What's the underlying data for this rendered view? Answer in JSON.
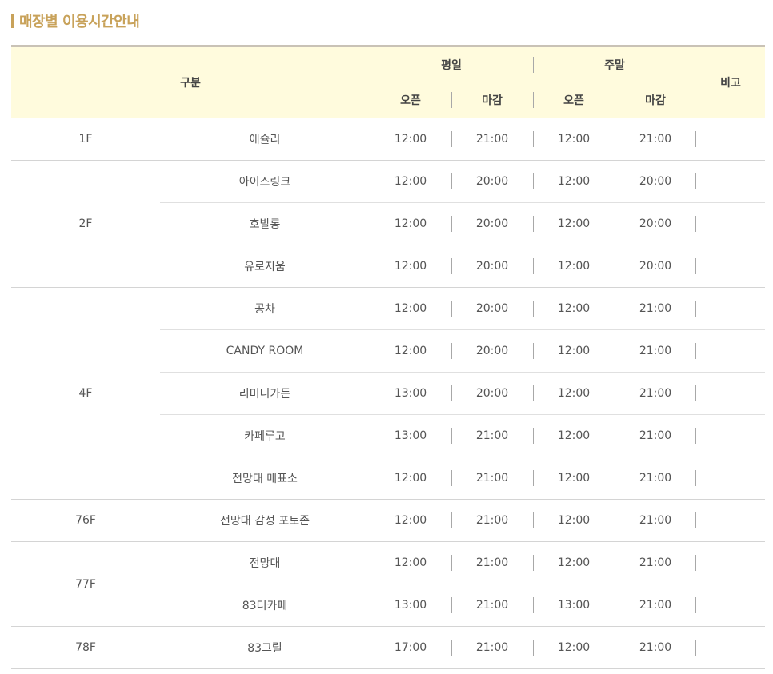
{
  "title": "매장별 이용시간안내",
  "header": {
    "gubun": "구분",
    "weekday": "평일",
    "weekend": "주말",
    "open": "오픈",
    "close": "마감",
    "note": "비고"
  },
  "rows": [
    {
      "floor": "1F",
      "name": "애슐리",
      "wd_open": "12:00",
      "wd_close": "21:00",
      "we_open": "12:00",
      "we_close": "21:00"
    },
    {
      "floor": "2F",
      "name": "아이스링크",
      "wd_open": "12:00",
      "wd_close": "20:00",
      "we_open": "12:00",
      "we_close": "20:00"
    },
    {
      "floor": "",
      "name": "호발롱",
      "wd_open": "12:00",
      "wd_close": "20:00",
      "we_open": "12:00",
      "we_close": "20:00"
    },
    {
      "floor": "",
      "name": "유로지움",
      "wd_open": "12:00",
      "wd_close": "20:00",
      "we_open": "12:00",
      "we_close": "20:00"
    },
    {
      "floor": "4F",
      "name": "공차",
      "wd_open": "12:00",
      "wd_close": "20:00",
      "we_open": "12:00",
      "we_close": "21:00"
    },
    {
      "floor": "",
      "name": "CANDY ROOM",
      "wd_open": "12:00",
      "wd_close": "20:00",
      "we_open": "12:00",
      "we_close": "21:00"
    },
    {
      "floor": "",
      "name": "리미니가든",
      "wd_open": "13:00",
      "wd_close": "20:00",
      "we_open": "12:00",
      "we_close": "21:00"
    },
    {
      "floor": "",
      "name": "카페루고",
      "wd_open": "13:00",
      "wd_close": "21:00",
      "we_open": "12:00",
      "we_close": "21:00"
    },
    {
      "floor": "",
      "name": "전망대 매표소",
      "wd_open": "12:00",
      "wd_close": "21:00",
      "we_open": "12:00",
      "we_close": "21:00"
    },
    {
      "floor": "76F",
      "name": "전망대 감성 포토존",
      "wd_open": "12:00",
      "wd_close": "21:00",
      "we_open": "12:00",
      "we_close": "21:00"
    },
    {
      "floor": "77F",
      "name": "전망대",
      "wd_open": "12:00",
      "wd_close": "21:00",
      "we_open": "12:00",
      "we_close": "21:00"
    },
    {
      "floor": "",
      "name": "83더카페",
      "wd_open": "13:00",
      "wd_close": "21:00",
      "we_open": "13:00",
      "we_close": "21:00"
    },
    {
      "floor": "78F",
      "name": "83그릴",
      "wd_open": "17:00",
      "wd_close": "21:00",
      "we_open": "12:00",
      "we_close": "21:00"
    }
  ]
}
